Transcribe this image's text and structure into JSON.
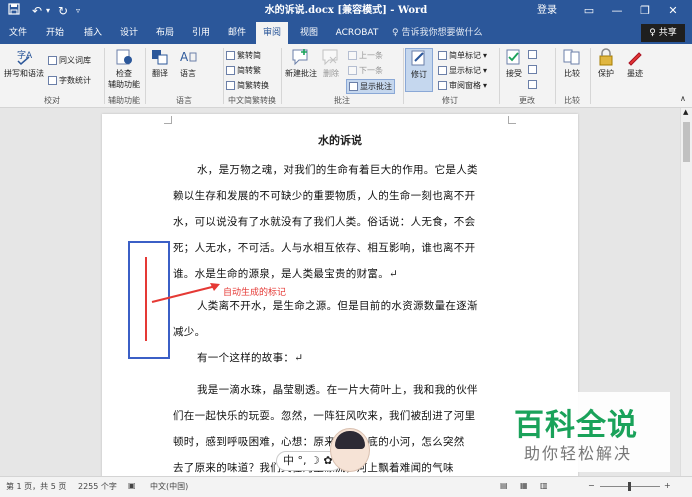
{
  "titlebar": {
    "save_icon": "save-icon",
    "undo_icon": "undo-icon",
    "redo_icon": "redo-icon",
    "title": "水的诉说.docx [兼容模式] - Word",
    "login": "登录",
    "ribbon_options_icon": "ribbon-options-icon",
    "minimize": "—",
    "restore": "❐",
    "close": "✕"
  },
  "tabs": [
    "文件",
    "开始",
    "插入",
    "设计",
    "布局",
    "引用",
    "邮件",
    "审阅",
    "视图",
    "ACROBAT"
  ],
  "active_tab": "审阅",
  "tellme": "♀ 告诉我你想要做什么",
  "share": "♀ 共享",
  "ribbon": {
    "proofing": {
      "spelling": "拼写和语法",
      "thesaurus": "同义词库",
      "wordcount": "字数统计",
      "label": "校对"
    },
    "accessibility": {
      "check": "检查",
      "check2": "辅助功能",
      "label": "辅助功能"
    },
    "language": {
      "translate": "翻译",
      "language": "语言",
      "label": "语言"
    },
    "chinese": {
      "t2s": "繁转简",
      "s2t": "简转繁",
      "convert": "简繁转换",
      "label": "中文简繁转换"
    },
    "comments": {
      "new": "新建批注",
      "delete": "删除",
      "prev": "上一条",
      "next": "下一条",
      "show": "显示批注",
      "label": "批注"
    },
    "tracking": {
      "track": "修订",
      "markup": "简单标记",
      "show_markup": "显示标记",
      "pane": "审阅窗格",
      "label": "修订"
    },
    "changes": {
      "accept": "接受",
      "label": "更改"
    },
    "compare": {
      "compare": "比较",
      "label": "比较"
    },
    "protect": {
      "protect": "保护"
    },
    "ink": {
      "ink": "墨迹"
    }
  },
  "document": {
    "title": "水的诉说",
    "lines": [
      "水，是万物之魂，对我们的生命有着巨大的作用。它是人类",
      "赖以生存和发展的不可缺少的重要物质，人的生命一刻也离不开",
      "水，可以说没有了水就没有了我们人类。俗话说：人无食，不会",
      "死；人无水，不可活。人与水相互依存、相互影响，谁也离不开",
      "谁。水是生命的源泉，是人类最宝贵的财富。↵",
      "人类离不开水，是生命之源。但是目前的水资源数量在逐渐",
      "减少。",
      "有一个这样的故事：↵",
      "我是一滴水珠，晶莹剔透。在一片大荷叶上，我和我的伙伴",
      "们在一起快乐的玩耍。忽然，一阵狂风吹来，我们被刮进了河里",
      "顿时，感到呼吸困难，心想：原来清澈见底的小河，怎么突然",
      "去了原来的味道？我们又在河里漂流，河上飘着难闻的气味"
    ]
  },
  "annotation": {
    "label": "自动生成的标记",
    "color": "#e53935",
    "box_color": "#3b5fc6"
  },
  "ime": {
    "text": "中 °, ☽ ✿"
  },
  "watermark": {
    "line1": "百科全说",
    "line2": "助你轻松解决",
    "color": "#1aa25a"
  },
  "status": {
    "page": "第 1 页，共 5 页",
    "words": "2255 个字",
    "language": "中文(中国)",
    "zoom_minus": "−",
    "zoom_plus": "+"
  },
  "colors": {
    "accent": "#2b579a"
  }
}
